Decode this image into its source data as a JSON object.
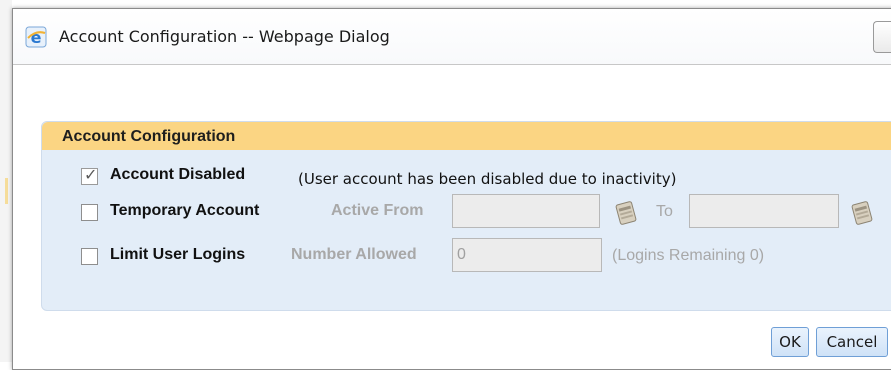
{
  "dialog": {
    "title": "Account Configuration -- Webpage Dialog",
    "title_icon": "internet-explorer-icon"
  },
  "panel": {
    "title": "Account Configuration",
    "accent_color": "#fbd583",
    "background_color": "#e3edf8"
  },
  "account_disabled": {
    "label": "Account Disabled",
    "checked": true,
    "note": "(User account has been disabled due to inactivity)"
  },
  "temporary_account": {
    "label": "Temporary Account",
    "checked": false,
    "active_from_label": "Active From",
    "active_from_value": "",
    "to_label": "To",
    "to_value": ""
  },
  "limit_logins": {
    "label": "Limit User Logins",
    "checked": false,
    "number_allowed_label": "Number Allowed",
    "number_allowed_value": "0",
    "remaining_text": "(Logins Remaining 0)"
  },
  "buttons": {
    "ok": "OK",
    "cancel": "Cancel"
  }
}
